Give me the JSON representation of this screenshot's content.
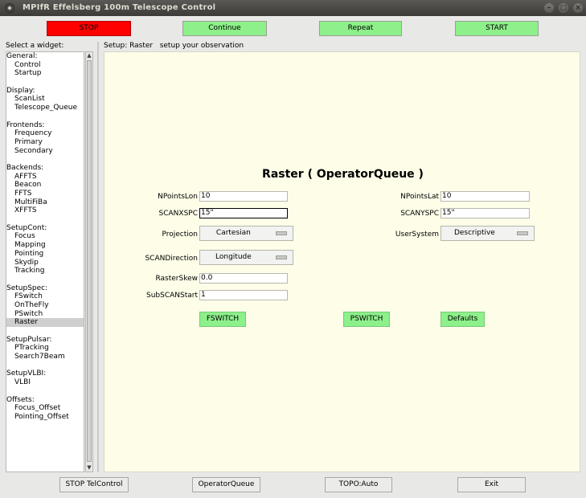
{
  "window": {
    "title": "MPIfR Effelsberg 100m Telescope Control",
    "buttons": {
      "minimize": "–",
      "maximize": "□",
      "close": "×"
    }
  },
  "toolbar": {
    "stop": "STOP",
    "continue": "Continue",
    "repeat": "Repeat",
    "start": "START",
    "colors": {
      "stop": "#ff0000",
      "action": "#8df08a"
    }
  },
  "sidebar": {
    "label": "Select a widget:",
    "groups": [
      {
        "title": "General:",
        "items": [
          "Control",
          "Startup"
        ]
      },
      {
        "title": "Display:",
        "items": [
          "ScanList",
          "Telescope_Queue"
        ]
      },
      {
        "title": "Frontends:",
        "items": [
          "Frequency",
          "Primary",
          "Secondary"
        ]
      },
      {
        "title": "Backends:",
        "items": [
          "AFFTS",
          "Beacon",
          "FFTS",
          "MultiFiBa",
          "XFFTS"
        ]
      },
      {
        "title": "SetupCont:",
        "items": [
          "Focus",
          "Mapping",
          "Pointing",
          "Skydip",
          "Tracking"
        ]
      },
      {
        "title": "SetupSpec:",
        "items": [
          "FSwitch",
          "OnTheFly",
          "PSwitch",
          "Raster"
        ]
      },
      {
        "title": "SetupPulsar:",
        "items": [
          "PTracking",
          "Search7Beam"
        ]
      },
      {
        "title": "SetupVLBI:",
        "items": [
          "VLBI"
        ]
      },
      {
        "title": "Offsets:",
        "items": [
          "Focus_Offset",
          "Pointing_Offset"
        ]
      }
    ],
    "selected": "Raster"
  },
  "setup": {
    "header": "Setup: Raster   setup your observation",
    "title": "Raster ( OperatorQueue )",
    "fields": {
      "npointslon": {
        "label": "NPointsLon",
        "value": "10"
      },
      "npointslat": {
        "label": "NPointsLat",
        "value": "10"
      },
      "scanxspc": {
        "label": "SCANXSPC",
        "value": "15\""
      },
      "scanyspc": {
        "label": "SCANYSPC",
        "value": "15\""
      },
      "projection": {
        "label": "Projection",
        "value": "Cartesian"
      },
      "usersystem": {
        "label": "UserSystem",
        "value": "Descriptive"
      },
      "scandirection": {
        "label": "SCANDirection",
        "value": "Longitude"
      },
      "rasterskew": {
        "label": "RasterSkew",
        "value": "0.0"
      },
      "subscanstart": {
        "label": "SubSCANStart",
        "value": "1"
      }
    },
    "buttons": {
      "fswitch": "FSWITCH",
      "pswitch": "PSWITCH",
      "defaults": "Defaults"
    }
  },
  "bottom": {
    "stop_telcontrol": "STOP TelControl",
    "operator_queue": "OperatorQueue",
    "topo": "TOPO:Auto",
    "exit": "Exit"
  }
}
